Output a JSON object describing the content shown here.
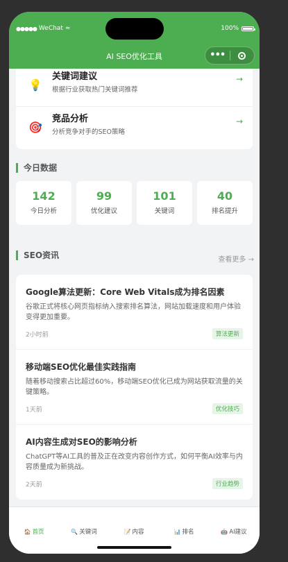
{
  "status_bar": {
    "carrier": "WeChat",
    "battery": "100%"
  },
  "nav": {
    "title": "AI SEO优化工具",
    "more_icon": "ellipsis-icon",
    "close_icon": "target-circle-icon"
  },
  "features": [
    {
      "icon": "💡",
      "title": "关键词建议",
      "desc": "根据行业获取热门关键词推荐",
      "arrow": "→"
    },
    {
      "icon": "🎯",
      "title": "竞品分析",
      "desc": "分析竞争对手的SEO策略",
      "arrow": "→"
    }
  ],
  "today": {
    "section_title": "今日数据",
    "stats": [
      {
        "value": "142",
        "label": "今日分析"
      },
      {
        "value": "99",
        "label": "优化建议"
      },
      {
        "value": "101",
        "label": "关键词"
      },
      {
        "value": "40",
        "label": "排名提升"
      }
    ]
  },
  "news": {
    "section_title": "SEO资讯",
    "view_more": "查看更多 →",
    "items": [
      {
        "title": "Google算法更新：Core Web Vitals成为排名因素",
        "summary": "谷歌正式将核心网页指标纳入搜索排名算法，网站加载速度和用户体验变得更加重要。",
        "time": "2小时前",
        "tag": "算法更新"
      },
      {
        "title": "移动端SEO优化最佳实践指南",
        "summary": "随着移动搜索占比超过60%，移动端SEO优化已成为网站获取流量的关键策略。",
        "time": "1天前",
        "tag": "优化技巧"
      },
      {
        "title": "AI内容生成对SEO的影响分析",
        "summary": "ChatGPT等AI工具的普及正在改变内容创作方式，如何平衡AI效率与内容质量成为新挑战。",
        "time": "2天前",
        "tag": "行业趋势"
      }
    ]
  },
  "tabs": [
    {
      "icon": "🏠",
      "label": "首页"
    },
    {
      "icon": "🔍",
      "label": "关键词"
    },
    {
      "icon": "📝",
      "label": "内容"
    },
    {
      "icon": "📊",
      "label": "排名"
    },
    {
      "icon": "🤖",
      "label": "AI建议"
    }
  ],
  "colors": {
    "accent": "#4cae50",
    "background": "#f2f3f5"
  }
}
